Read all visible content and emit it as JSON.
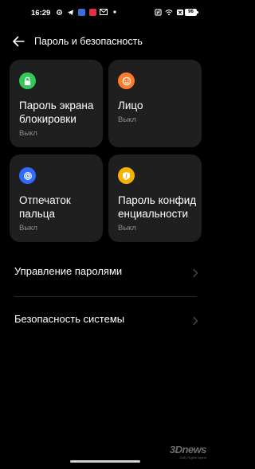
{
  "status_bar": {
    "time": "16:29",
    "battery": "96",
    "left_icons": [
      "gear-icon",
      "telegram-icon",
      "vk-icon",
      "app-red-icon",
      "gmail-icon",
      "dot-icon"
    ],
    "right_icons": [
      "nfc-icon",
      "wifi-icon",
      "sim-icon"
    ]
  },
  "header": {
    "title": "Пароль и безопасность"
  },
  "cards": [
    {
      "label": "Пароль экрана блокировки",
      "status": "Выкл",
      "icon": "lock-icon",
      "color": "#34c759"
    },
    {
      "label": "Лицо",
      "status": "Выкл",
      "icon": "face-icon",
      "color": "#ff7a2a"
    },
    {
      "label": "Отпечаток пальца",
      "status": "Выкл",
      "icon": "fingerprint-icon",
      "color": "#2f6bff"
    },
    {
      "label": "Пароль конфиденциальности",
      "status": "Выкл",
      "icon": "shield-icon",
      "color": "#f6b200"
    }
  ],
  "card_label_lines": [
    [
      "Пароль экрана",
      "блокировки"
    ],
    [
      "Лицо"
    ],
    [
      "Отпечаток",
      "пальца"
    ],
    [
      "Пароль конфид",
      "енциальности"
    ]
  ],
  "rows": [
    {
      "label": "Управление паролями"
    },
    {
      "label": "Безопасность системы"
    }
  ],
  "watermark": {
    "brand": "3Dnews",
    "tagline": "Daily Digital Digest"
  }
}
